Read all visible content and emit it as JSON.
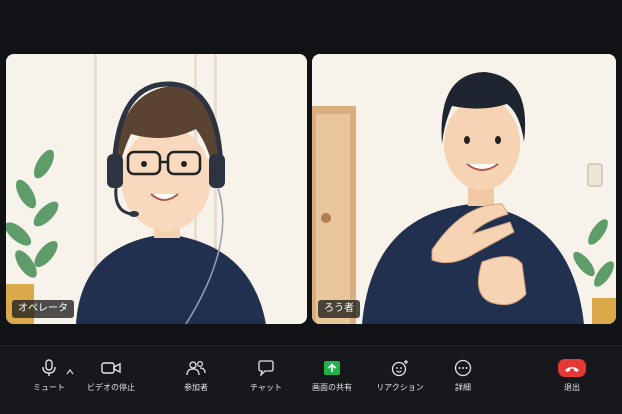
{
  "participants": [
    {
      "name": "オペレータ"
    },
    {
      "name": "ろう者"
    }
  ],
  "toolbar": {
    "mute_label": "ミュート",
    "video_label": "ビデオの停止",
    "participants_label": "参加者",
    "chat_label": "チャット",
    "share_label": "画面の共有",
    "reactions_label": "リアクション",
    "more_label": "詳細",
    "leave_label": "退出"
  },
  "colors": {
    "background": "#101216",
    "toolbar": "#16181c",
    "share_green": "#22b24c",
    "leave_red": "#e53935",
    "shirt_navy": "#223050"
  }
}
